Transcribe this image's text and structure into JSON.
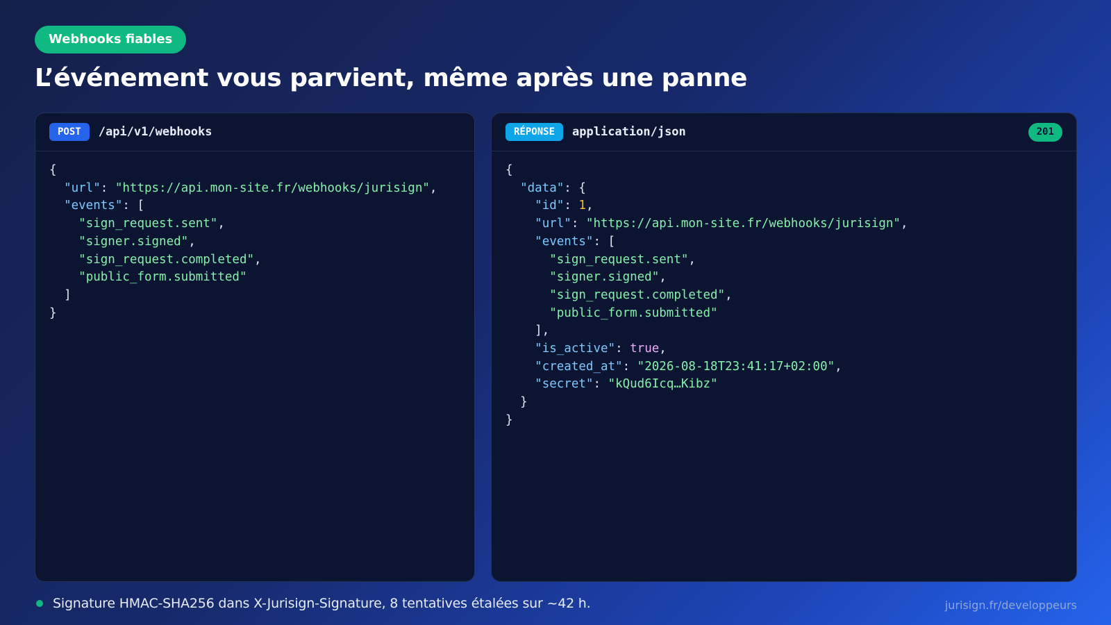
{
  "badge": "Webhooks fiables",
  "title": "L’événement vous parvient, même après une panne",
  "request": {
    "method": "POST",
    "endpoint": "/api/v1/webhooks",
    "body": {
      "url": "https://api.mon-site.fr/webhooks/jurisign",
      "events": [
        "sign_request.sent",
        "signer.signed",
        "sign_request.completed",
        "public_form.submitted"
      ]
    }
  },
  "response": {
    "label": "RÉPONSE",
    "content_type": "application/json",
    "status": "201",
    "body": {
      "data": {
        "id": 1,
        "url": "https://api.mon-site.fr/webhooks/jurisign",
        "events": [
          "sign_request.sent",
          "signer.signed",
          "sign_request.completed",
          "public_form.submitted"
        ],
        "is_active": true,
        "created_at": "2026-08-18T23:41:17+02:00",
        "secret": "kQud6Icq…Kibz"
      }
    }
  },
  "footer": {
    "note": "Signature HMAC-SHA256 dans X-Jurisign-Signature, 8 tentatives étalées sur ~42 h.",
    "link": "jurisign.fr/developpeurs"
  },
  "colors": {
    "accent_green": "#10b981",
    "post_badge": "#2563eb",
    "response_badge": "#0ea5e9",
    "json_key": "#7cc8ff",
    "json_string": "#86efac",
    "json_number": "#fbbf24",
    "json_boolean": "#f0abfc"
  }
}
